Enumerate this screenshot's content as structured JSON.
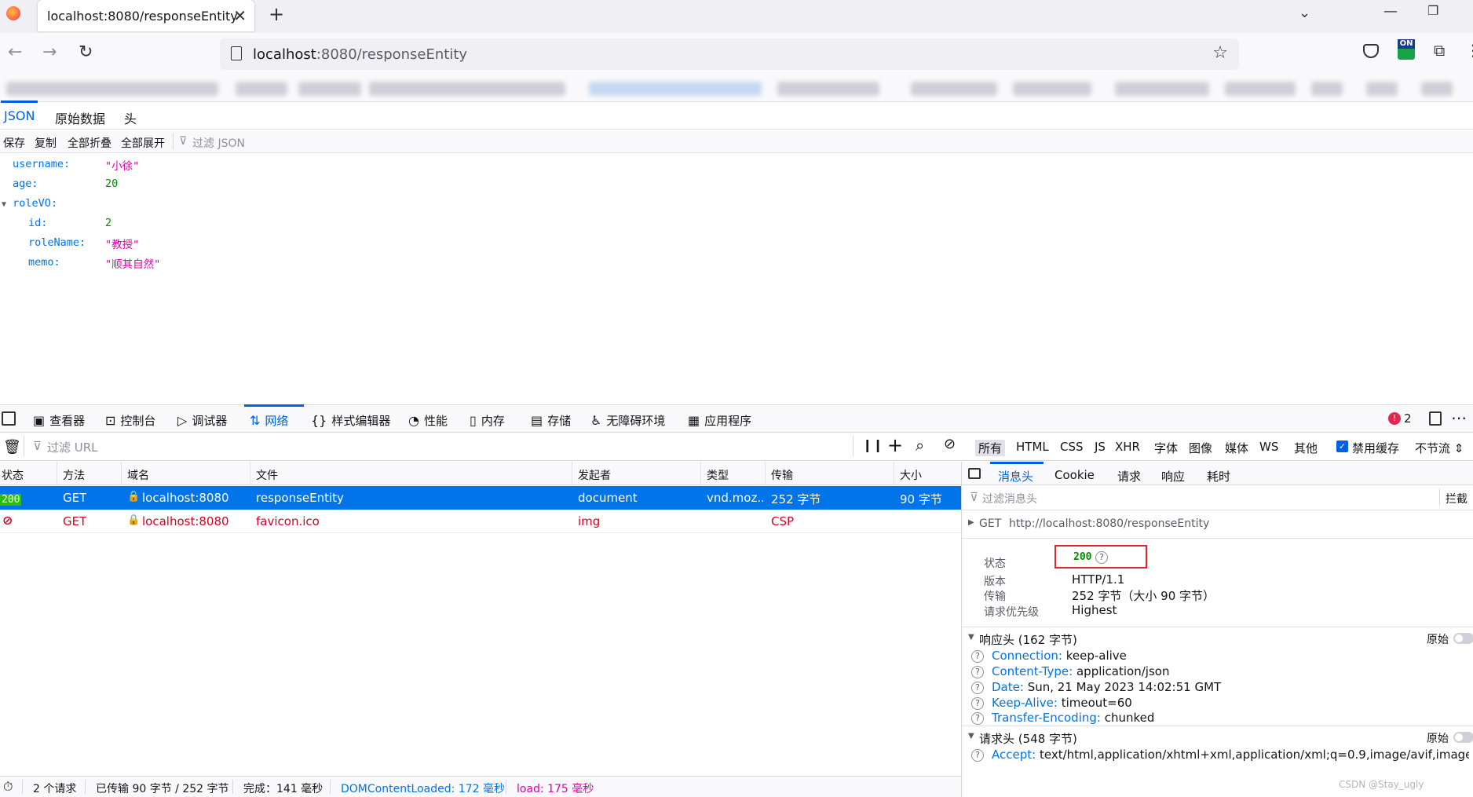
{
  "browser": {
    "tab_title": "localhost:8080/responseEntity",
    "url_host": "localhost",
    "url_path": ":8080/responseEntity",
    "ext_badge": "ON"
  },
  "json_viewer": {
    "tabs": [
      "JSON",
      "原始数据",
      "头"
    ],
    "toolbar": [
      "保存",
      "复制",
      "全部折叠",
      "全部展开"
    ],
    "filter_placeholder": "过滤 JSON",
    "rows": [
      {
        "key": "username:",
        "value": "\"小徐\"",
        "kind": "str"
      },
      {
        "key": "age:",
        "value": "20",
        "kind": "num"
      },
      {
        "key": "roleVO:",
        "value": "",
        "kind": "obj"
      },
      {
        "key": "id:",
        "value": "2",
        "kind": "num"
      },
      {
        "key": "roleName:",
        "value": "\"教授\"",
        "kind": "str"
      },
      {
        "key": "memo:",
        "value": "\"顺其自然\"",
        "kind": "str"
      }
    ]
  },
  "devtools": {
    "tabs": [
      "查看器",
      "控制台",
      "调试器",
      "网络",
      "样式编辑器",
      "性能",
      "内存",
      "存储",
      "无障碍环境",
      "应用程序"
    ],
    "error_count": "2",
    "filter_url_placeholder": "过滤 URL",
    "type_filters": [
      "所有",
      "HTML",
      "CSS",
      "JS",
      "XHR",
      "字体",
      "图像",
      "媒体",
      "WS",
      "其他"
    ],
    "disable_cache": "禁用缓存",
    "throttle": "不节流 ⇕",
    "columns": [
      "状态",
      "方法",
      "域名",
      "文件",
      "发起者",
      "类型",
      "传输",
      "大小"
    ],
    "requests": [
      {
        "status": "200",
        "method": "GET",
        "domain": "localhost:8080",
        "file": "responseEntity",
        "initiator": "document",
        "type": "vnd.moz...",
        "transfer": "252 字节",
        "size": "90 字节"
      },
      {
        "status": "",
        "method": "GET",
        "domain": "localhost:8080",
        "file": "favicon.ico",
        "initiator": "img",
        "type": "",
        "transfer": "CSP",
        "size": ""
      }
    ],
    "status_bar": {
      "requests": "2 个请求",
      "transferred": "已传输 90 字节 / 252 字节",
      "finish": "完成：141 毫秒",
      "dcl": "DOMContentLoaded: 172 毫秒",
      "load": "load: 175 毫秒"
    }
  },
  "details": {
    "tabs": [
      "消息头",
      "Cookie",
      "请求",
      "响应",
      "耗时"
    ],
    "filter_placeholder": "过滤消息头",
    "block": "拦截",
    "request_line_method": "GET",
    "request_line_url": "http://localhost:8080/responseEntity",
    "summary": [
      {
        "k": "状态",
        "v": "200"
      },
      {
        "k": "版本",
        "v": "HTTP/1.1"
      },
      {
        "k": "传输",
        "v": "252 字节（大小 90 字节）"
      },
      {
        "k": "请求优先级",
        "v": "Highest"
      }
    ],
    "response_headers_title": "响应头 (162 字节)",
    "raw_label": "原始",
    "response_headers": [
      {
        "name": "Connection:",
        "value": "keep-alive"
      },
      {
        "name": "Content-Type:",
        "value": "application/json"
      },
      {
        "name": "Date:",
        "value": "Sun, 21 May 2023 14:02:51 GMT"
      },
      {
        "name": "Keep-Alive:",
        "value": "timeout=60"
      },
      {
        "name": "Transfer-Encoding:",
        "value": "chunked"
      }
    ],
    "request_headers_title": "请求头 (548 字节)",
    "request_headers": [
      {
        "name": "Accept:",
        "value": "text/html,application/xhtml+xml,application/xml;q=0.9,image/avif,image/webp,*/"
      }
    ],
    "watermark": "CSDN @Stay_ugly"
  },
  "colors": {
    "accent": "#0061e0",
    "selected_row": "#0074e8",
    "status_ok": "#2cbb0f",
    "error": "#d70022",
    "highlight_box": "#e0242c"
  }
}
